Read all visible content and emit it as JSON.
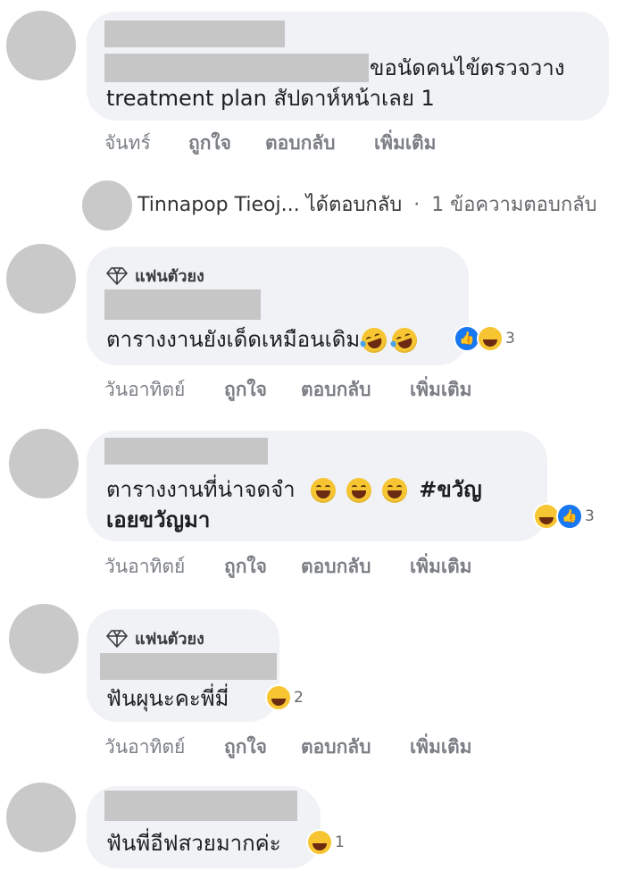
{
  "comment1": {
    "text_line1": "ขอนัดคนไข้ตรวจวาง",
    "text_line2": "treatment plan สัปดาห์หน้าเลย 1",
    "actions": {
      "time": "จันทร์",
      "like": "ถูกใจ",
      "reply": "ตอบกลับ",
      "more": "เพิ่มเติม"
    }
  },
  "reply_summary": {
    "name": "Tinnapop Tieoj...",
    "action": "ได้ตอบกลับ",
    "separator": "·",
    "count": "1 ข้อความตอบกลับ"
  },
  "comment2": {
    "badge": "แฟนตัวยง",
    "text": "ตารางงานยังเด็ดเหมือนเดิม",
    "reaction_count": "3",
    "reactions": [
      "like-icon",
      "haha-icon"
    ],
    "actions": {
      "time": "วันอาทิตย์",
      "like": "ถูกใจ",
      "reply": "ตอบกลับ",
      "more": "เพิ่มเติม"
    }
  },
  "comment3": {
    "text_line1": "ตารางงานที่น่าจดจำ",
    "hashtag_line1": "#ขวัญ",
    "hashtag_line2": "เอยขวัญมา",
    "reaction_count": "3",
    "reactions": [
      "haha-icon",
      "like-icon"
    ],
    "actions": {
      "time": "วันอาทิตย์",
      "like": "ถูกใจ",
      "reply": "ตอบกลับ",
      "more": "เพิ่มเติม"
    }
  },
  "comment4": {
    "badge": "แฟนตัวยง",
    "text": "ฟันผุนะคะพี่มี่",
    "reaction_count": "2",
    "reactions": [
      "haha-icon"
    ],
    "actions": {
      "time": "วันอาทิตย์",
      "like": "ถูกใจ",
      "reply": "ตอบกลับ",
      "more": "เพิ่มเติม"
    }
  },
  "comment5": {
    "text": "ฟันพี่อีฟสวยมากค่ะ",
    "reaction_count": "1",
    "reactions": [
      "haha-icon"
    ]
  },
  "colors": {
    "bubble": "#f0f2f5",
    "avatar": "#c9c9c9",
    "redaction": "#c6c6c6",
    "like_blue": "#1877f2",
    "muted": "#7b7f85"
  }
}
